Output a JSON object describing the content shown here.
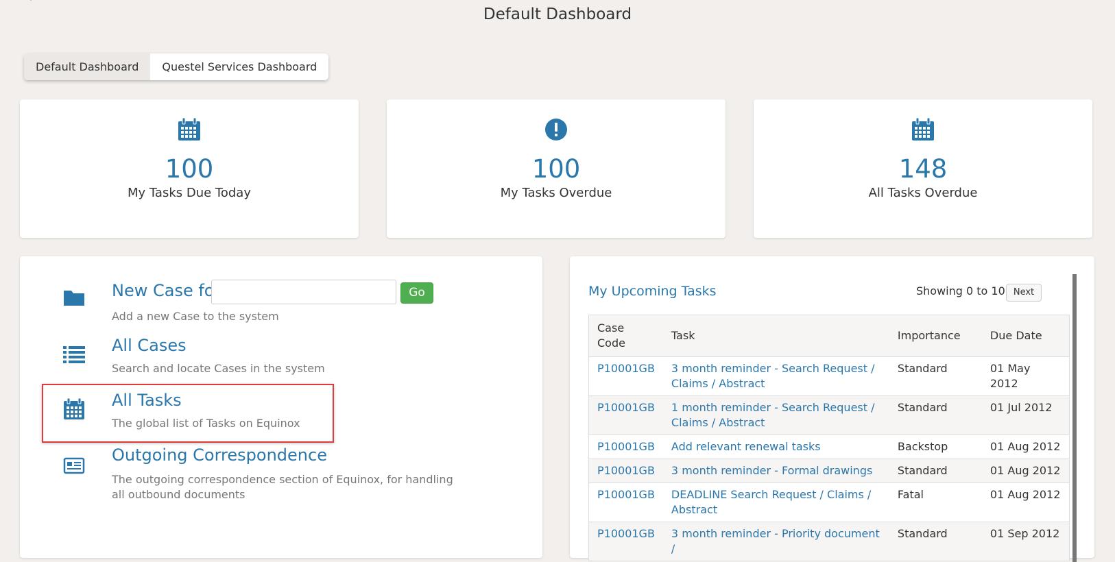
{
  "page": {
    "title": "Default Dashboard"
  },
  "tabs": [
    {
      "label": "Default Dashboard",
      "active": true
    },
    {
      "label": "Questel Services Dashboard",
      "active": false
    }
  ],
  "stats": [
    {
      "value": "100",
      "label": "My Tasks Due Today",
      "icon": "calendar-icon"
    },
    {
      "value": "100",
      "label": "My Tasks Overdue",
      "icon": "alert-icon"
    },
    {
      "value": "148",
      "label": "All Tasks Overdue",
      "icon": "calendar-icon"
    }
  ],
  "links": [
    {
      "title": "New Case for",
      "desc": "Add a new Case to the system",
      "icon": "folder-icon",
      "input_value": "",
      "go_label": "Go"
    },
    {
      "title": "All Cases",
      "desc": "Search and locate Cases in the system",
      "icon": "list-icon"
    },
    {
      "title": "All Tasks",
      "desc": "The global list of Tasks on Equinox",
      "icon": "calendar-icon"
    },
    {
      "title": "Outgoing Correspondence",
      "desc": "The outgoing correspondence section of Equinox, for handling all outbound documents",
      "icon": "correspondence-icon"
    }
  ],
  "upcoming": {
    "title": "My Upcoming Tasks",
    "showing": "Showing 0 to 10",
    "next_label": "Next",
    "columns": [
      "Case Code",
      "Task",
      "Importance",
      "Due Date"
    ],
    "rows": [
      [
        "P10001GB",
        "3 month reminder - Search Request / Claims / Abstract",
        "Standard",
        "01 May 2012"
      ],
      [
        "P10001GB",
        "1 month reminder - Search Request / Claims / Abstract",
        "Standard",
        "01 Jul 2012"
      ],
      [
        "P10001GB",
        "Add relevant renewal tasks",
        "Backstop",
        "01 Aug 2012"
      ],
      [
        "P10001GB",
        "3 month reminder - Formal drawings",
        "Standard",
        "01 Aug 2012"
      ],
      [
        "P10001GB",
        "DEADLINE Search Request / Claims / Abstract",
        "Fatal",
        "01 Aug 2012"
      ],
      [
        "P10001GB",
        "3 month reminder - Priority document /",
        "Standard",
        "01 Sep 2012"
      ]
    ]
  },
  "colors": {
    "accent": "#2a77ab",
    "go_button": "#4fae4f",
    "highlight": "#e03a3a",
    "background": "#f2efec"
  }
}
